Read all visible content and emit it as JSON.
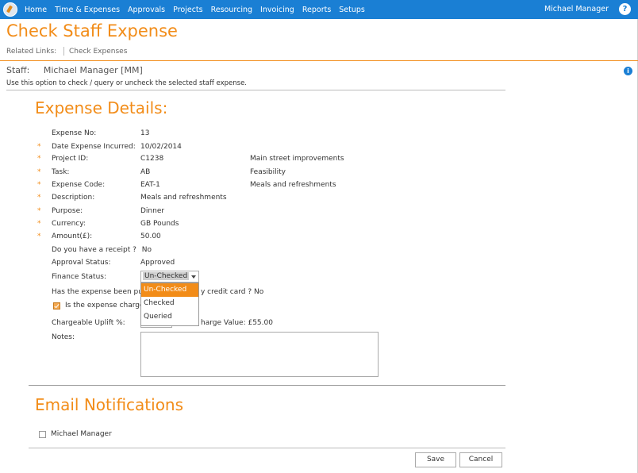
{
  "nav": {
    "items": [
      "Home",
      "Time & Expenses",
      "Approvals",
      "Projects",
      "Resourcing",
      "Invoicing",
      "Reports",
      "Setups"
    ],
    "user": "Michael Manager",
    "help": "?"
  },
  "page": {
    "title": "Check Staff Expense",
    "related_label": "Related Links:",
    "related_link": "Check Expenses",
    "staff_label": "Staff:",
    "staff_value": "Michael Manager [MM]",
    "hint": "Use this option to check / query or uncheck the selected staff expense.",
    "info": "i"
  },
  "expense": {
    "section_title": "Expense Details:",
    "required_mark": "*",
    "fields": {
      "expense_no": {
        "label": "Expense No:",
        "value": "13"
      },
      "date": {
        "label": "Date Expense Incurred:",
        "value": "10/02/2014"
      },
      "project": {
        "label": "Project ID:",
        "value": "C1238",
        "desc": "Main street improvements"
      },
      "task": {
        "label": "Task:",
        "value": "AB",
        "desc": "Feasibility"
      },
      "code": {
        "label": "Expense Code:",
        "value": "EAT-1",
        "desc": "Meals and refreshments"
      },
      "description": {
        "label": "Description:",
        "value": "Meals and refreshments"
      },
      "purpose": {
        "label": "Purpose:",
        "value": "Dinner"
      },
      "currency": {
        "label": "Currency:",
        "value": "GB Pounds"
      },
      "amount": {
        "label": "Amount(£):",
        "value": "50.00"
      },
      "receipt": {
        "label": "Do you have a receipt ?",
        "value": "No"
      },
      "approval": {
        "label": "Approval Status:",
        "value": "Approved"
      },
      "finance": {
        "label": "Finance Status:",
        "value": "Un-Checked",
        "options": [
          "Un-Checked",
          "Checked",
          "Queried"
        ]
      },
      "purchased": {
        "label": "Has the expense been purch",
        "suffix": "y credit card ? No"
      },
      "chargeable": {
        "label": "Is the expense chargeab",
        "checked": true
      },
      "uplift": {
        "label": "Chargeable Uplift %:",
        "charge_text": "harge Value: £55.00"
      },
      "notes": {
        "label": "Notes:",
        "value": ""
      }
    }
  },
  "email": {
    "section_title": "Email Notifications",
    "recipients": [
      {
        "name": "Michael Manager",
        "checked": false
      }
    ]
  },
  "buttons": {
    "save": "Save",
    "cancel": "Cancel"
  }
}
